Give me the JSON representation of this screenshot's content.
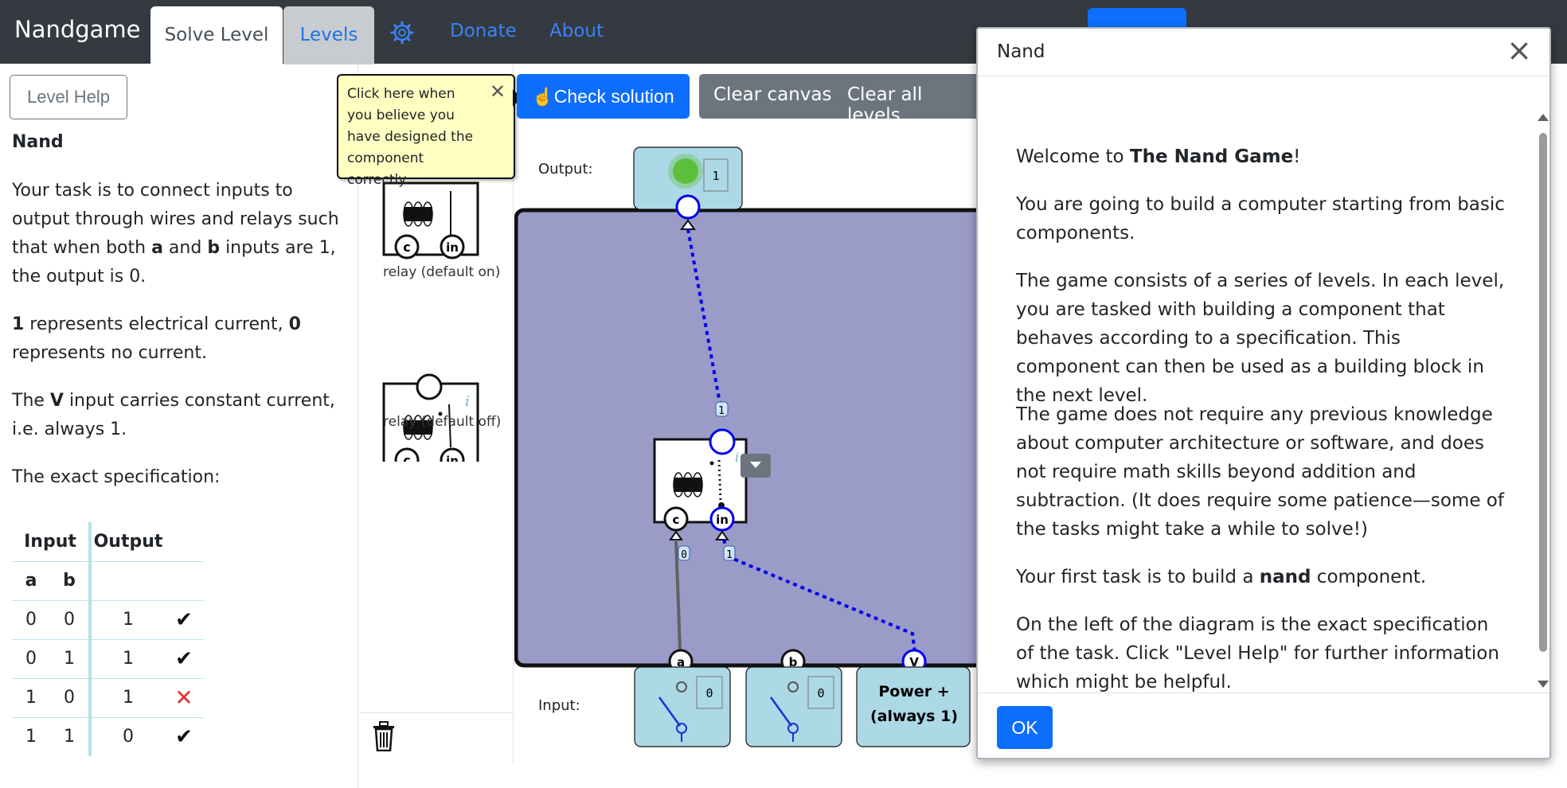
{
  "navbar": {
    "brand": "Nandgame",
    "tab_solve": "Solve Level",
    "tab_levels": "Levels",
    "settings_icon": "gear-icon",
    "donate": "Donate",
    "about": "About"
  },
  "left": {
    "level_help": "Level Help",
    "title": "Nand",
    "p1_parts": [
      "Your task is to connect inputs to output through wires and relays such that when both ",
      "a",
      " and ",
      "b",
      " inputs are 1, the output is 0."
    ],
    "p2_parts": [
      "1",
      " represents electrical current, ",
      "0",
      " represents no current."
    ],
    "p3_parts": [
      "The ",
      "V",
      " input carries constant current, i.e. always 1."
    ],
    "p4": "The exact specification:",
    "table": {
      "head_input": "Input",
      "head_output": "Output",
      "col_a": "a",
      "col_b": "b",
      "rows": [
        {
          "a": "0",
          "b": "0",
          "out": "1",
          "status": "check"
        },
        {
          "a": "0",
          "b": "1",
          "out": "1",
          "status": "check"
        },
        {
          "a": "1",
          "b": "0",
          "out": "1",
          "status": "cross"
        },
        {
          "a": "1",
          "b": "1",
          "out": "0",
          "status": "check"
        }
      ]
    }
  },
  "palette": {
    "items": [
      "relay (default on)",
      "relay (default off)"
    ],
    "trash_icon": "trash-icon"
  },
  "toolbar": {
    "tooltip": "Click here when you believe you have designed the component correctly.",
    "check_solution": "Check solution",
    "clear_canvas": "Clear canvas",
    "clear_all_levels": "Clear all levels"
  },
  "canvas": {
    "output_label": "Output:",
    "input_label": "Input:",
    "output_value": "1",
    "input_a_value": "0",
    "input_b_value": "0",
    "power_label_1": "Power +",
    "power_label_2": "(always 1)",
    "pin_a": "a",
    "pin_b": "b",
    "pin_v": "V",
    "pin_c": "c",
    "pin_in": "in",
    "info_glyph": "i",
    "wire_labels": [
      "1",
      "0",
      "1"
    ],
    "colors": {
      "board": "#9b9bc8",
      "wire_on": "#0000ee",
      "wire_off": "#606060",
      "node": "#add8e6"
    }
  },
  "modal": {
    "title": "Nand",
    "p1_parts": [
      "Welcome to ",
      "The Nand Game",
      "!"
    ],
    "p2": "You are going to build a computer starting from basic components.",
    "p3": "The game consists of a series of levels. In each level, you are tasked with building a component that behaves according to a specification. This component can then be used as a building block in the next level.",
    "p4": "The game does not require any previous knowledge about computer architecture or software, and does not require math skills beyond addition and subtraction. (It does require some patience—some of the tasks might take a while to solve!)",
    "p5_parts": [
      "Your first task is to build a ",
      "nand",
      " component."
    ],
    "p6": "On the left of the diagram is the exact specification of the task. Click \"Level Help\" for further information which might be helpful.",
    "ok": "OK"
  }
}
